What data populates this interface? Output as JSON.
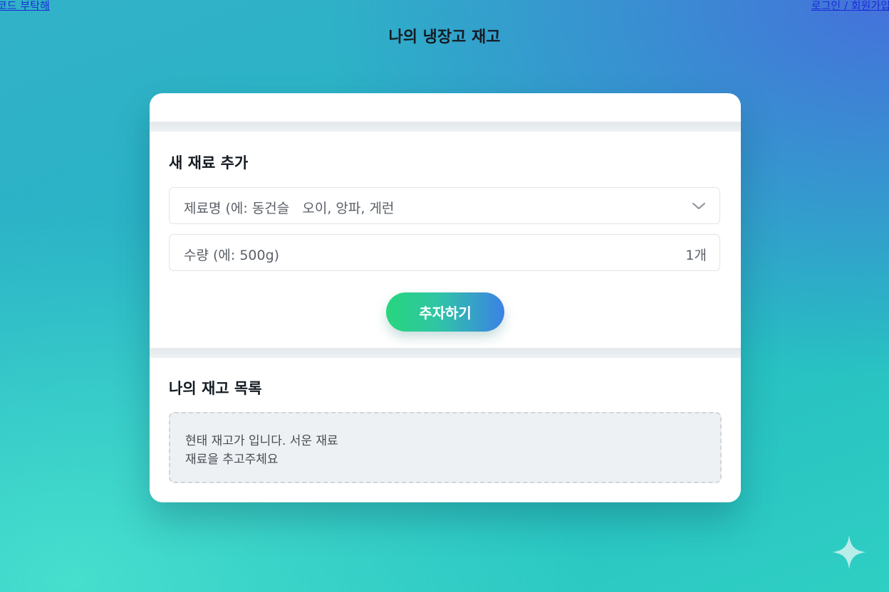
{
  "top_links": {
    "left": "코드 부탁해",
    "right": "로그인 / 회원가입"
  },
  "page": {
    "title": "나의 냉장고 재고"
  },
  "add_section": {
    "title": "새 재료 추가",
    "ingredient_placeholder": "제료명 (에: 동건슬   오이, 앙파, 게런",
    "quantity_placeholder": "수량 (에: 500g)",
    "quantity_unit": "1개",
    "add_button_label": "추자하기"
  },
  "inventory_section": {
    "title": "나의 재고 목록",
    "empty_line1": "현태 재고가 입니다. 서운 재료",
    "empty_line2": "재료을 추고주체요"
  },
  "colors": {
    "button_gradient_start": "#27d67c",
    "button_gradient_end": "#3b82e6",
    "link": "#1a2bd8"
  },
  "icons": {
    "dropdown": "chevron-down-icon",
    "corner": "sparkle-icon"
  }
}
